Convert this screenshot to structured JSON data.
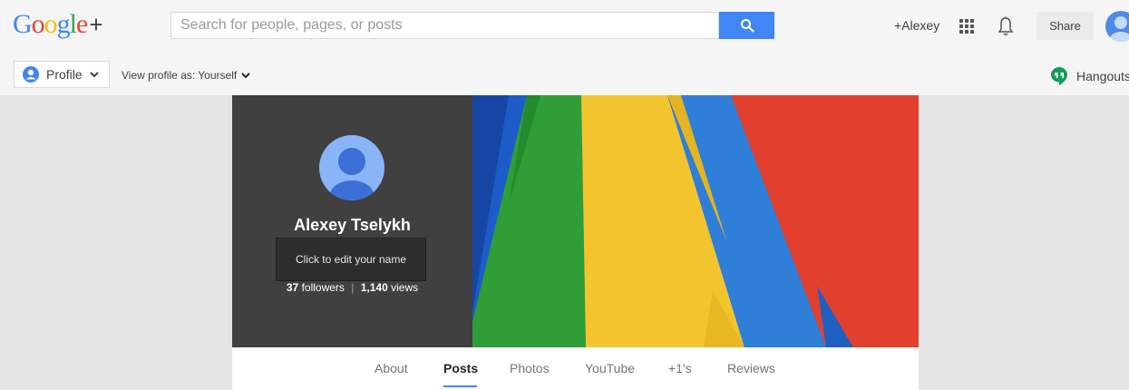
{
  "app": {
    "logo_text": "Google",
    "logo_plus": "+"
  },
  "search": {
    "placeholder": "Search for people, pages, or posts",
    "value": ""
  },
  "header": {
    "user_link": "+Alexey",
    "share_label": "Share",
    "icons": [
      "search-icon",
      "apps-grid-icon",
      "bell-icon",
      "avatar"
    ]
  },
  "subbar": {
    "profile_label": "Profile",
    "view_as_label": "View profile as: Yourself",
    "hangouts_label": "Hangouts"
  },
  "profile": {
    "name": "Alexey Tselykh",
    "tooltip": "Click to edit your name",
    "followers_count": "37",
    "followers_label": "followers",
    "separator": "|",
    "views_count": "1,140",
    "views_label": "views"
  },
  "tabs": [
    {
      "label": "About",
      "active": false
    },
    {
      "label": "Posts",
      "active": true
    },
    {
      "label": "Photos",
      "active": false
    },
    {
      "label": "YouTube",
      "active": false
    },
    {
      "label": "+1's",
      "active": false
    },
    {
      "label": "Reviews",
      "active": false
    }
  ],
  "colors": {
    "accent": "#4285f4",
    "cover_left": "#404040",
    "cover_blue": "#1a57c4",
    "cover_green": "#2ea83a",
    "cover_yellow": "#f4c430",
    "cover_red": "#e1392b"
  }
}
